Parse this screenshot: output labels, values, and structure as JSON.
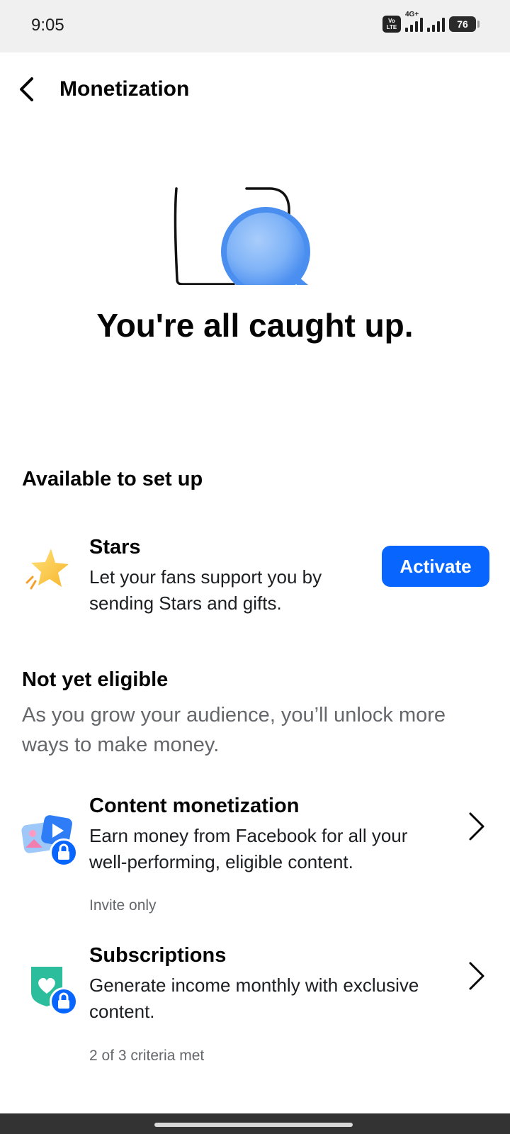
{
  "status_bar": {
    "time": "9:05",
    "volte_label": "Vo LTE",
    "network_label": "4G+",
    "battery_level": "76"
  },
  "header": {
    "back_icon": "chevron-left-icon",
    "title": "Monetization"
  },
  "hero": {
    "message": "You're all caught up."
  },
  "available": {
    "heading": "Available to set up",
    "items": [
      {
        "icon": "star-icon",
        "title": "Stars",
        "description": "Let your fans support you by sending Stars and gifts.",
        "button_label": "Activate"
      }
    ]
  },
  "not_eligible": {
    "heading": "Not yet eligible",
    "description": "As you grow your audience, you’ll unlock more ways to make money.",
    "items": [
      {
        "icon": "content-monetization-icon",
        "title": "Content monetization",
        "description": "Earn money from Facebook for all your well-performing, eligible content.",
        "status": "Invite only"
      },
      {
        "icon": "subscriptions-heart-icon",
        "title": "Subscriptions",
        "description": "Generate income monthly with exclusive content.",
        "status": "2 of 3 criteria met"
      }
    ]
  },
  "colors": {
    "accent": "#0866ff",
    "text_primary": "#050505",
    "text_secondary": "#65676b"
  }
}
